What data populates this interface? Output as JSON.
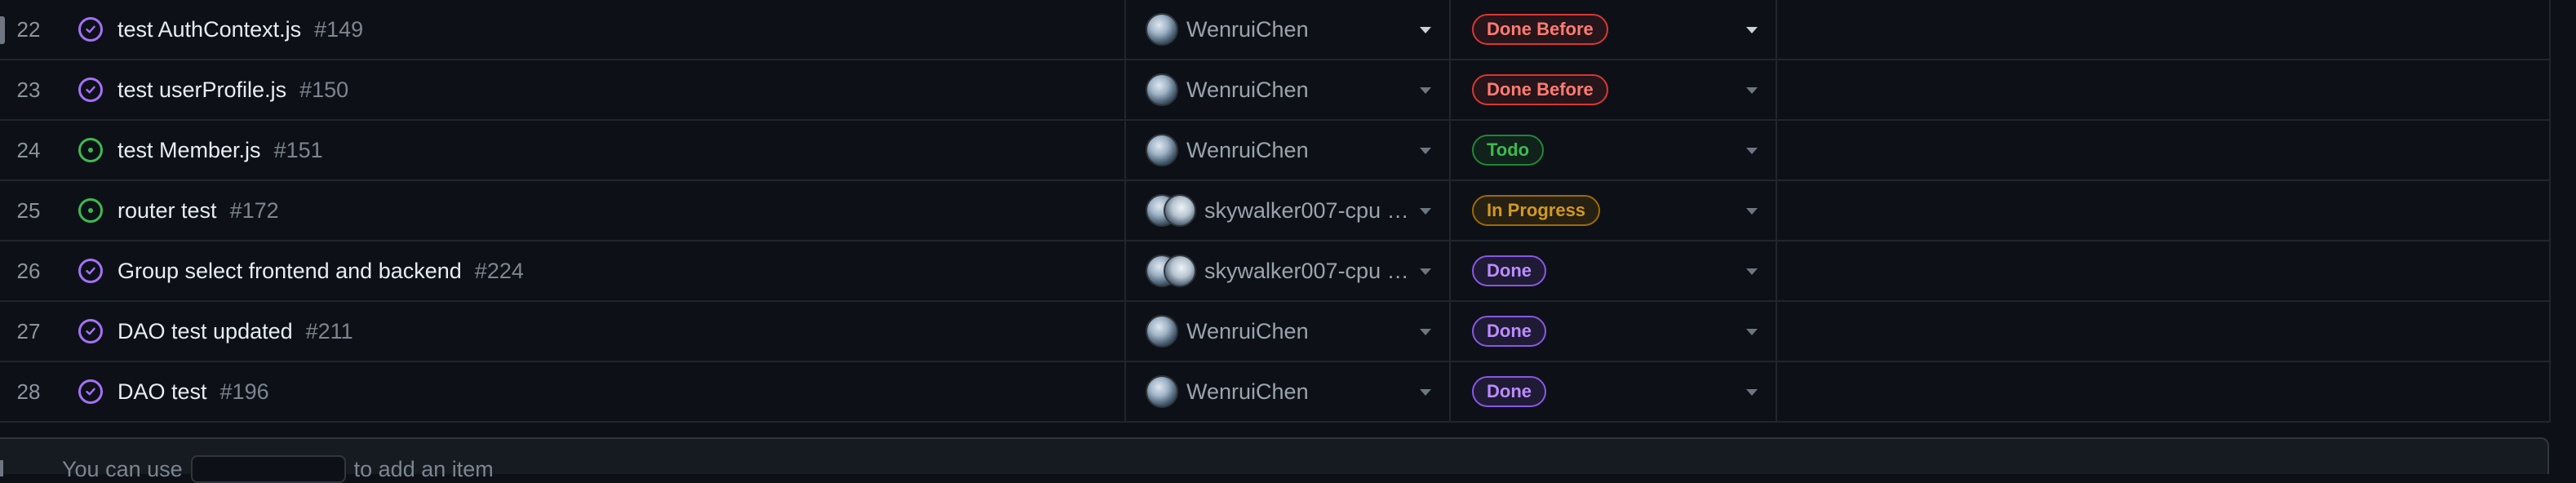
{
  "rows": [
    {
      "num": "22",
      "title": "test AuthContext.js",
      "issue": "#149",
      "state": "closed",
      "assignees": "WenruiChen",
      "multi": false,
      "status": "Done Before",
      "status_color": "red",
      "active": true
    },
    {
      "num": "23",
      "title": "test userProfile.js",
      "issue": "#150",
      "state": "closed",
      "assignees": "WenruiChen",
      "multi": false,
      "status": "Done Before",
      "status_color": "red",
      "active": false
    },
    {
      "num": "24",
      "title": "test Member.js",
      "issue": "#151",
      "state": "open",
      "assignees": "WenruiChen",
      "multi": false,
      "status": "Todo",
      "status_color": "green",
      "active": false
    },
    {
      "num": "25",
      "title": "router test",
      "issue": "#172",
      "state": "open",
      "assignees": "skywalker007-cpu a...",
      "multi": true,
      "status": "In Progress",
      "status_color": "yellow",
      "active": false
    },
    {
      "num": "26",
      "title": "Group select frontend and backend",
      "issue": "#224",
      "state": "closed",
      "assignees": "skywalker007-cpu a...",
      "multi": true,
      "status": "Done",
      "status_color": "purple",
      "active": false
    },
    {
      "num": "27",
      "title": "DAO test updated",
      "issue": "#211",
      "state": "closed",
      "assignees": "WenruiChen",
      "multi": false,
      "status": "Done",
      "status_color": "purple",
      "active": false
    },
    {
      "num": "28",
      "title": "DAO test",
      "issue": "#196",
      "state": "closed",
      "assignees": "WenruiChen",
      "multi": false,
      "status": "Done",
      "status_color": "purple",
      "active": false
    }
  ],
  "footer": {
    "prefix": "You can use",
    "suffix": "to add an item"
  },
  "colors": {
    "background": "#0d1117",
    "closed_icon": "#a371f7",
    "open_icon": "#3fb950"
  }
}
